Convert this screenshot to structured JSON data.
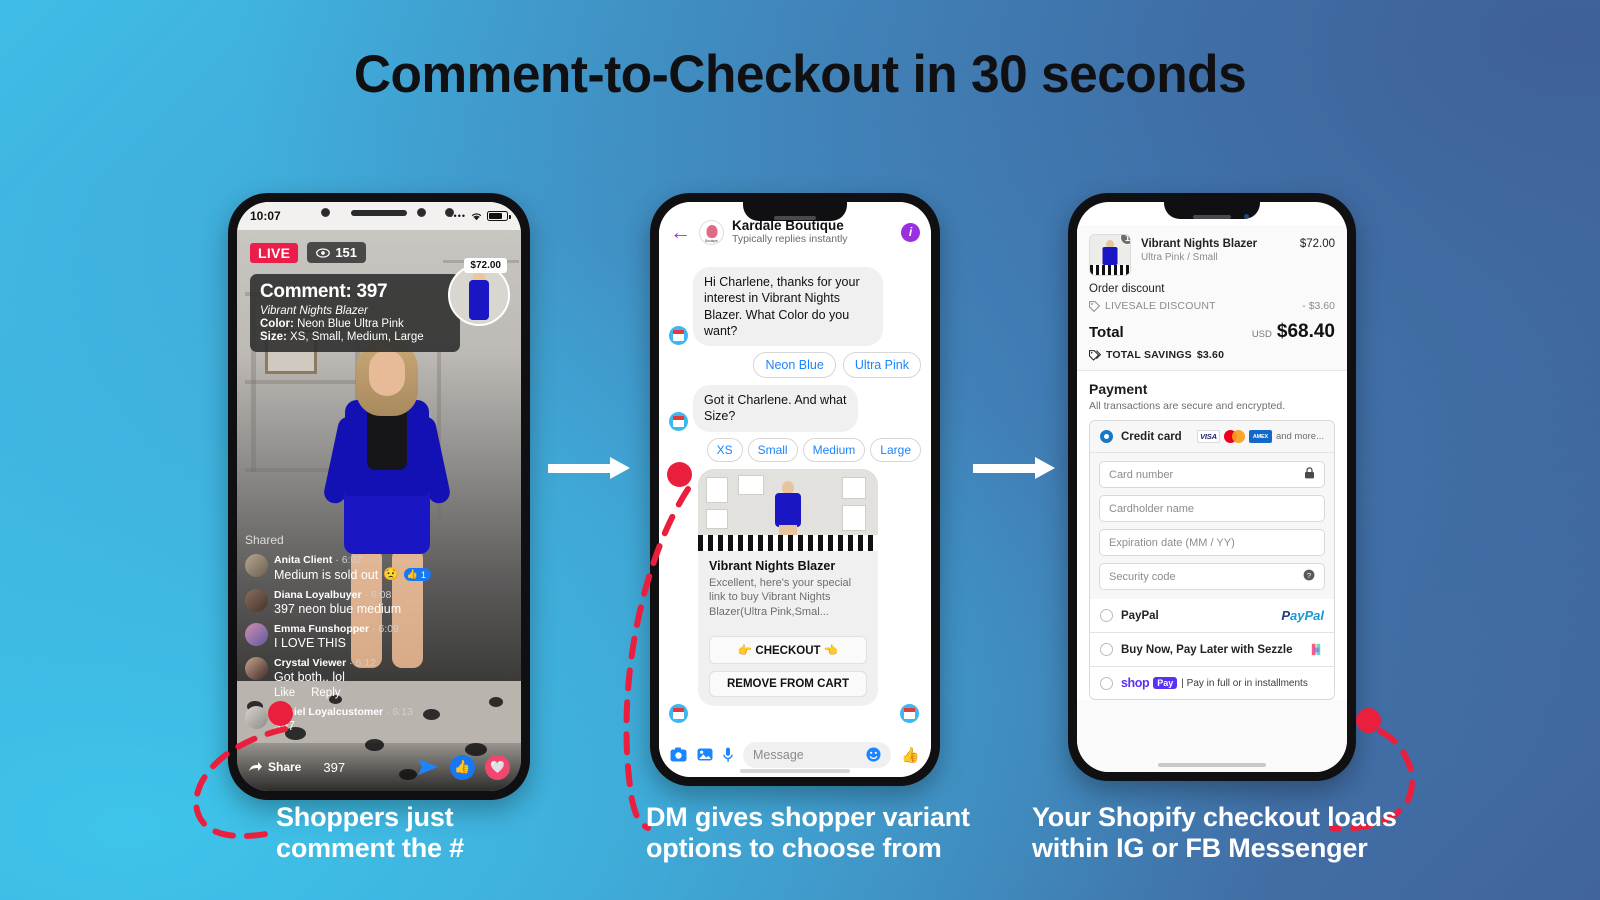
{
  "title": "Comment-to-Checkout in 30 seconds",
  "colors": {
    "accent_red": "#ea1f3d",
    "live_red": "#ec1e49",
    "messenger_blue": "#1b84ff",
    "shopify_purple": "#5a31f4",
    "bg_light": "#3fbde6",
    "bg_dark": "#41649d"
  },
  "phone1": {
    "status": {
      "time": "10:07",
      "signal": "••••",
      "wifi": "wifi-icon",
      "battery": "battery-icon"
    },
    "live_badge": "LIVE",
    "viewers": "151",
    "comment_card": {
      "headline": "Comment: 397",
      "product": "Vibrant Nights Blazer",
      "color_label": "Color:",
      "color_value": "Neon Blue Ultra Pink",
      "size_label": "Size:",
      "size_value": "XS, Small, Medium, Large"
    },
    "price_tag": "$72.00",
    "shared_text": "Shared",
    "comments": [
      {
        "name": "Anita Client",
        "time": "6:07",
        "text": "Medium is sold out",
        "emoji": "😟",
        "reaction": "1"
      },
      {
        "name": "Diana Loyalbuyer",
        "time": "6:08",
        "text": "397 neon blue medium",
        "emoji": "",
        "reaction": ""
      },
      {
        "name": "Emma Funshopper",
        "time": "6:09",
        "text": "I LOVE THIS",
        "emoji": "",
        "reaction": ""
      },
      {
        "name": "Crystal Viewer",
        "time": "6:12",
        "text": "Got both.. lol",
        "emoji": "",
        "reaction": ""
      },
      {
        "name": "Daniel Loyalcustomer",
        "time": "6:13",
        "text": "397",
        "emoji": "",
        "reaction": ""
      }
    ],
    "like_label": "Like",
    "reply_label": "Reply",
    "bottom": {
      "share_label": "Share",
      "message_value": "397",
      "send_icon": "send-icon",
      "like_icon": "thumbs-up-icon",
      "heart_icon": "heart-icon"
    }
  },
  "phone2": {
    "header": {
      "back_icon": "back-arrow-icon",
      "name": "Kardale Boutique",
      "subtitle": "Typically replies instantly",
      "info_icon": "info-icon"
    },
    "messages": [
      {
        "from": "bot",
        "text": "Hi Charlene, thanks for your interest in Vibrant Nights Blazer. What Color do you want?"
      },
      {
        "from": "bot",
        "text": "Got it Charlene. And what Size?"
      }
    ],
    "color_options": [
      "Neon Blue",
      "Ultra Pink"
    ],
    "size_options": [
      "XS",
      "Small",
      "Medium",
      "Large"
    ],
    "product_card": {
      "title": "Vibrant Nights Blazer",
      "description": "Excellent, here's your special link to buy Vibrant Nights Blazer(Ultra Pink,Smal...",
      "checkout_button": "👉 CHECKOUT 👈",
      "remove_button": "REMOVE FROM CART"
    },
    "composer": {
      "camera_icon": "camera-icon",
      "gallery_icon": "image-icon",
      "mic_icon": "microphone-icon",
      "placeholder": "Message",
      "emoji_icon": "emoji-icon",
      "thumb_icon": "thumbs-up-icon"
    }
  },
  "phone3": {
    "line_item": {
      "quantity": "1",
      "name": "Vibrant Nights Blazer",
      "variant": "Ultra Pink / Small",
      "price": "$72.00"
    },
    "order_discount_label": "Order discount",
    "discount": {
      "icon": "tag-icon",
      "label": "LIVESALE DISCOUNT",
      "value": "- $3.60"
    },
    "total": {
      "label": "Total",
      "currency": "USD",
      "value": "$68.40"
    },
    "savings": {
      "icon": "tags-icon",
      "label": "TOTAL SAVINGS",
      "value": "$3.60"
    },
    "payment": {
      "heading": "Payment",
      "subtext": "All transactions are secure and encrypted.",
      "methods": [
        {
          "id": "credit-card",
          "label": "Credit card",
          "selected": true,
          "logos": [
            "VISA",
            "mastercard",
            "AMEX"
          ],
          "and_more": "and more..."
        },
        {
          "id": "paypal",
          "label": "PayPal",
          "selected": false,
          "logo_text": "PayPal"
        },
        {
          "id": "sezzle",
          "label": "Buy Now, Pay Later with Sezzle",
          "selected": false,
          "logo_text": ""
        },
        {
          "id": "shop-pay",
          "label": "",
          "selected": false,
          "logo_text": "shop Pay",
          "suffix": "| Pay in full or in installments"
        }
      ],
      "fields": [
        {
          "id": "card-number",
          "placeholder": "Card number",
          "icon": "lock-icon"
        },
        {
          "id": "cardholder-name",
          "placeholder": "Cardholder name",
          "icon": ""
        },
        {
          "id": "expiration-date",
          "placeholder": "Expiration date (MM / YY)",
          "icon": ""
        },
        {
          "id": "security-code",
          "placeholder": "Security code",
          "icon": "help-icon"
        }
      ]
    }
  },
  "captions": [
    {
      "line1": "Shoppers just",
      "line2": "comment the #"
    },
    {
      "line1": "DM gives shopper variant",
      "line2": "options to choose from"
    },
    {
      "line1": "Your Shopify checkout loads",
      "line2": "within IG or FB Messenger"
    }
  ]
}
